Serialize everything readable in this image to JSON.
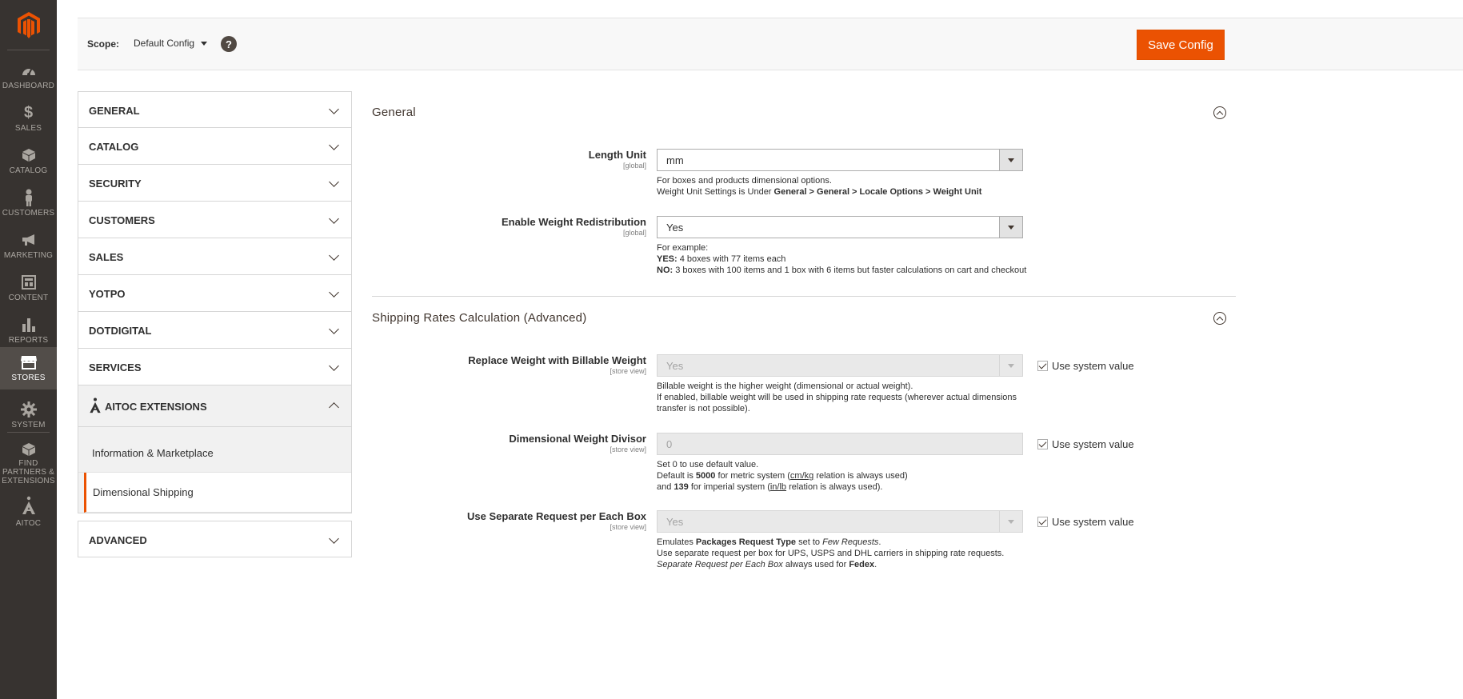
{
  "nav": {
    "items": [
      {
        "label": "DASHBOARD",
        "icon": "dashboard-icon"
      },
      {
        "label": "SALES",
        "icon": "dollar-icon"
      },
      {
        "label": "CATALOG",
        "icon": "box-icon"
      },
      {
        "label": "CUSTOMERS",
        "icon": "person-icon"
      },
      {
        "label": "MARKETING",
        "icon": "megaphone-icon"
      },
      {
        "label": "CONTENT",
        "icon": "layout-icon"
      },
      {
        "label": "REPORTS",
        "icon": "bar-chart-icon"
      },
      {
        "label": "STORES",
        "icon": "store-icon"
      },
      {
        "label": "SYSTEM",
        "icon": "gear-icon"
      },
      {
        "label": "FIND PARTNERS & EXTENSIONS",
        "icon": "cubes-icon"
      },
      {
        "label": "AITOC",
        "icon": "aitoc-icon"
      }
    ],
    "active": "STORES",
    "brand_color": "#eb5202",
    "bg_color": "#373330"
  },
  "scope": {
    "label": "Scope:",
    "value": "Default Config",
    "help": "?"
  },
  "toolbar": {
    "save_label": "Save Config"
  },
  "tabs": {
    "general": "GENERAL",
    "catalog": "CATALOG",
    "security": "SECURITY",
    "customers": "CUSTOMERS",
    "sales": "SALES",
    "yotpo": "YOTPO",
    "dotdigital": "DOTDIGITAL",
    "services": "SERVICES",
    "aitoc": "AITOC EXTENSIONS",
    "aitoc_items": {
      "info": "Information & Marketplace",
      "dimensional": "Dimensional Shipping"
    },
    "advanced": "ADVANCED"
  },
  "general_section": {
    "title": "General",
    "length_unit": {
      "label": "Length Unit",
      "scope": "[global]",
      "value": "mm",
      "note_line1": "For boxes and products dimensional options.",
      "note_line2_prefix": "Weight Unit Settings is Under ",
      "note_line2_path": "General > General > Locale Options > Weight Unit"
    },
    "weight_redistribution": {
      "label": "Enable Weight Redistribution",
      "scope": "[global]",
      "value": "Yes",
      "note_line1": "For example:",
      "yes_key": "YES:",
      "yes_text": " 4 boxes with 77 items each",
      "no_key": "NO:",
      "no_text": " 3 boxes with 100 items and 1 box with 6 items but faster calculations on cart and checkout"
    }
  },
  "shipping_section": {
    "title": "Shipping Rates Calculation (Advanced)",
    "use_system_value": "Use system value",
    "billable": {
      "label": "Replace Weight with Billable Weight",
      "scope": "[store view]",
      "value": "Yes",
      "note_line1": "Billable weight is the higher weight (dimensional or actual weight).",
      "note_line2": "If enabled, billable weight will be used in shipping rate requests (wherever actual dimensions transfer is not possible)."
    },
    "divisor": {
      "label": "Dimensional Weight Divisor",
      "scope": "[store view]",
      "value": "0",
      "note_line1": "Set 0 to use default value.",
      "metric_prefix": "Default is ",
      "metric_value": "5000",
      "metric_mid": " for metric system (",
      "metric_unit": "cm/kg",
      "metric_suffix": " relation is always used)",
      "imperial_prefix": "and ",
      "imperial_value": "139",
      "imperial_mid": " for imperial system (",
      "imperial_unit": "in/lb",
      "imperial_suffix": " relation is always used)."
    },
    "separate": {
      "label": "Use Separate Request per Each Box",
      "scope": "[store view]",
      "value": "Yes",
      "emulates_prefix": "Emulates ",
      "emulates_bold": "Packages Request Type",
      "emulates_mid": " set to ",
      "emulates_italic": "Few Requests",
      "emulates_suffix": ".",
      "note_line2": "Use separate request per box for UPS, USPS and DHL carriers in shipping rate requests.",
      "line3_italic": "Separate Request per Each Box",
      "line3_mid": " always used for ",
      "line3_bold": "Fedex",
      "line3_suffix": "."
    }
  }
}
